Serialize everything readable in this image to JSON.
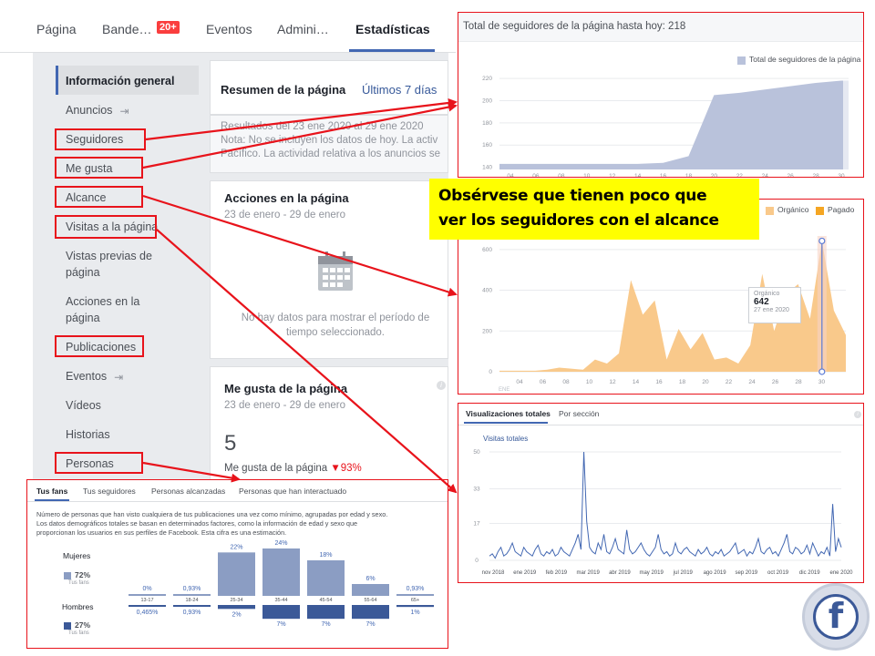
{
  "nav": {
    "tabs": [
      "Página",
      "Bande…",
      "Eventos",
      "Admini…",
      "Estadísticas"
    ],
    "badge": "20+"
  },
  "sidebar": {
    "items": [
      {
        "label": "Información general"
      },
      {
        "label": "Anuncios"
      },
      {
        "label": "Seguidores"
      },
      {
        "label": "Me gusta"
      },
      {
        "label": "Alcance"
      },
      {
        "label": "Visitas a la página"
      },
      {
        "label": "Vistas previas de página"
      },
      {
        "label": "Acciones en la página"
      },
      {
        "label": "Publicaciones"
      },
      {
        "label": "Eventos"
      },
      {
        "label": "Vídeos"
      },
      {
        "label": "Historias"
      },
      {
        "label": "Personas"
      }
    ]
  },
  "main": {
    "summary_title": "Resumen de la página",
    "summary_range": "Últimos 7 días",
    "results_text_1": "Resultados del 23 ene 2020 al 29 ene 2020",
    "results_text_2": "Nota: No se incluyen los datos de hoy. La activ",
    "results_text_3": "Pacífico. La actividad relativa a los anuncios se",
    "actions_title": "Acciones en la página",
    "actions_dates": "23 de enero - 29 de enero",
    "no_data": "No hay datos para mostrar el período de tiempo seleccionado.",
    "likes_title": "Me gusta de la página",
    "likes_dates": "23 de enero - 29 de enero",
    "likes_value": "5",
    "likes_label": "Me gusta de la página",
    "likes_change": "▼93%"
  },
  "annotation": {
    "line1": "Obsérvese que tienen poco que",
    "line2": "ver los seguidores con el alcance"
  },
  "colors": {
    "highlight": "#e8131b",
    "note": "#ffff00",
    "brand": "#4267b2",
    "organic": "#f9c98b",
    "paid": "#f5a623",
    "followers": "#b9c2db"
  },
  "followers_panel": {
    "title": "Total de seguidores de la página hasta hoy: 218",
    "legend": "Total de seguidores de la página"
  },
  "reach_panel": {
    "legend_organic": "Orgánico",
    "legend_paid": "Pagado",
    "tooltip_label": "Orgánico",
    "tooltip_value": "642",
    "tooltip_date": "27 ene 2020",
    "x_sub": "ENE"
  },
  "views_panel": {
    "tab_total": "Visualizaciones totales",
    "tab_section": "Por sección",
    "series_label": "Visitas totales"
  },
  "people_panel": {
    "tabs": [
      "Tus fans",
      "Tus seguidores",
      "Personas alcanzadas",
      "Personas que han interactuado"
    ],
    "desc_1": "Número de personas que han visto cualquiera de tus publicaciones una vez como mínimo, agrupadas por edad y sexo.",
    "desc_2": "Los datos demográficos totales se basan en determinados factores, como la información de edad y sexo que",
    "desc_3": "proporcionan los usuarios en sus perfiles de Facebook. Esta cifra es una estimación.",
    "women_label": "Mujeres",
    "women_pct": "72%",
    "women_sub": "Tus fans",
    "men_label": "Hombres",
    "men_pct": "27%",
    "men_sub": "Tus fans"
  },
  "chart_data": [
    {
      "type": "area",
      "title": "Total de seguidores de la página hasta hoy: 218",
      "x": [
        "04",
        "06",
        "08",
        "10",
        "12",
        "14",
        "16",
        "18",
        "20",
        "22",
        "24",
        "26",
        "28",
        "30"
      ],
      "series": [
        {
          "name": "Total de seguidores de la página",
          "values": [
            143,
            143,
            143,
            143,
            143,
            143,
            144,
            150,
            205,
            207,
            210,
            213,
            216,
            218
          ]
        }
      ],
      "yticks": [
        140,
        160,
        180,
        200,
        220
      ],
      "ylim": [
        138,
        225
      ]
    },
    {
      "type": "area",
      "x": [
        "04",
        "06",
        "08",
        "10",
        "12",
        "14",
        "16",
        "18",
        "20",
        "22",
        "24",
        "26",
        "28",
        "30"
      ],
      "series": [
        {
          "name": "Orgánico",
          "values": [
            5,
            5,
            5,
            5,
            10,
            20,
            15,
            10,
            60,
            40,
            90,
            450,
            280,
            350,
            60,
            210,
            110,
            190,
            60,
            70,
            40,
            130,
            480,
            200,
            380,
            430,
            260,
            642,
            300,
            180
          ]
        },
        {
          "name": "Pagado",
          "values": []
        }
      ],
      "yticks": [
        0,
        200,
        400,
        600
      ],
      "ylim": [
        0,
        720
      ]
    },
    {
      "type": "line",
      "series": [
        {
          "name": "Visitas totales",
          "values": [
            2,
            3,
            1,
            4,
            6,
            2,
            3,
            5,
            8,
            4,
            3,
            2,
            6,
            4,
            3,
            2,
            5,
            7,
            3,
            2,
            4,
            3,
            5,
            2,
            3,
            6,
            4,
            3,
            2,
            5,
            8,
            12,
            5,
            50,
            18,
            6,
            4,
            3,
            8,
            5,
            12,
            4,
            3,
            6,
            10,
            5,
            4,
            3,
            14,
            5,
            3,
            4,
            6,
            8,
            5,
            3,
            2,
            4,
            6,
            12,
            5,
            3,
            4,
            2,
            3,
            8,
            4,
            3,
            5,
            6,
            4,
            3,
            2,
            5,
            3,
            4,
            6,
            3,
            2,
            4,
            3,
            5,
            2,
            3,
            4,
            6,
            8,
            3,
            4,
            5,
            2,
            4,
            3,
            6,
            10,
            4,
            3,
            5,
            6,
            3,
            4,
            2,
            5,
            8,
            12,
            4,
            3,
            6,
            5,
            3,
            4,
            7,
            3,
            8,
            5,
            2,
            4,
            3,
            6,
            2,
            26,
            4,
            10,
            6
          ]
        }
      ],
      "xticks": [
        "nov 2018",
        "ene 2019",
        "feb 2019",
        "mar 2019",
        "abr 2019",
        "may 2019",
        "jul 2019",
        "ago 2019",
        "sep 2019",
        "oct 2019",
        "dic 2019",
        "ene 2020"
      ],
      "yticks": [
        0,
        17,
        33,
        50
      ],
      "ylim": [
        0,
        50
      ]
    },
    {
      "type": "bar",
      "categories": [
        "13-17",
        "18-24",
        "25-34",
        "35-44",
        "45-54",
        "55-64",
        "65+"
      ],
      "series": [
        {
          "name": "Mujeres",
          "values": [
            0,
            0.93,
            22,
            24,
            18,
            6,
            0.93
          ]
        },
        {
          "name": "Hombres",
          "values": [
            0.465,
            0.93,
            2,
            7,
            7,
            7,
            1
          ]
        }
      ],
      "labels_women": [
        "0%",
        "0,93%",
        "22%",
        "24%",
        "18%",
        "6%",
        "0,93%"
      ],
      "labels_men": [
        "0,465%",
        "0,93%",
        "2%",
        "7%",
        "7%",
        "7%",
        "1%"
      ]
    }
  ]
}
